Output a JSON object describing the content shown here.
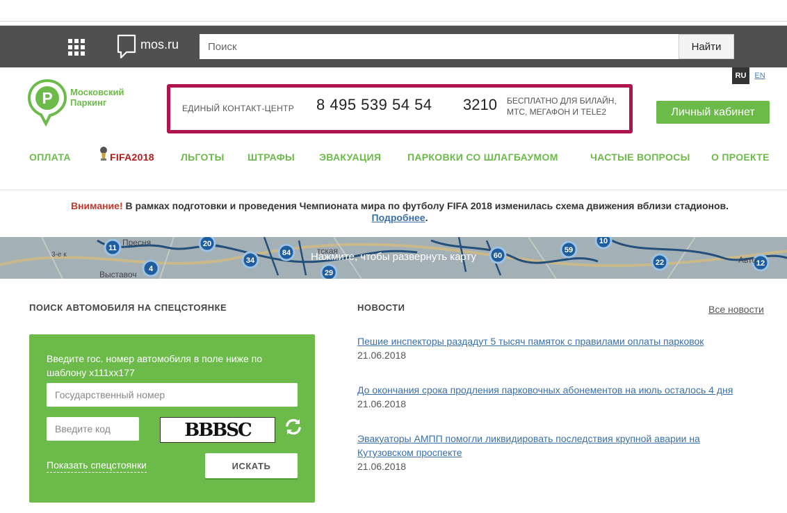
{
  "topbar": {
    "brand": "mos.ru",
    "search_placeholder": "Поиск",
    "search_button": "Найти"
  },
  "header": {
    "lang_ru": "RU",
    "lang_en": "EN",
    "logo_line1": "Московский",
    "logo_line2": "Паркинг",
    "contact_label": "ЕДИНЫЙ КОНТАКТ-ЦЕНТР",
    "contact_phone": "8 495 539 54 54",
    "contact_short": "3210",
    "contact_note": "БЕСПЛАТНО ДЛЯ БИЛАЙН, МТС, МЕГАФОН И TELE2",
    "cabinet_button": "Личный кабинет",
    "highlight_color": "#b0144f",
    "accent_color": "#6cba4a"
  },
  "nav": [
    {
      "label": "ОПЛАТА"
    },
    {
      "label": "FIFA2018"
    },
    {
      "label": "ЛЬГОТЫ"
    },
    {
      "label": "ШТРАФЫ"
    },
    {
      "label": "ЭВАКУАЦИЯ"
    },
    {
      "label": "ПАРКОВКИ СО ШЛАГБАУМОМ"
    },
    {
      "label": "ЧАСТЫЕ ВОПРОСЫ"
    },
    {
      "label": "О ПРОЕКТЕ"
    }
  ],
  "alert": {
    "warning": "Внимание!",
    "text": " В рамках подготовки и проведения Чемпионата мира по футболу FIFA 2018 изменилась схема движения вблизи стадионов. ",
    "link": "Подробнее",
    "end": "."
  },
  "map": {
    "text": "Нажмите, чтобы развернуть карту",
    "markers": [
      "11",
      "20",
      "4",
      "34",
      "84",
      "29",
      "60",
      "59",
      "10",
      "22",
      "12"
    ],
    "labels": [
      "Пресня",
      "Выставоч",
      "тская",
      "Авто",
      "3-е к"
    ]
  },
  "search_section": {
    "title": "ПОИСК АВТОМОБИЛЯ НА СПЕЦСТОЯНКЕ",
    "hint": "Введите гос. номер автомобиля в поле ниже по шаблону х111хх177",
    "plate_placeholder": "Государственный номер",
    "code_placeholder": "Введите код",
    "captcha_text": "BBBSC",
    "show_link": "Показать спецстоянки",
    "find_button": "ИСКАТЬ"
  },
  "news": {
    "title": "НОВОСТИ",
    "all_link": "Все новости",
    "items": [
      {
        "title": "Пешие инспекторы раздадут 5 тысяч памяток с правилами оплаты парковок",
        "date": "21.06.2018"
      },
      {
        "title": "До окончания срока продления парковочных абонементов на июль осталось 4 дня",
        "date": "21.06.2018"
      },
      {
        "title": "Эвакуаторы АМПП помогли ликвидировать последствия крупной аварии на Кутузовском проспекте",
        "date": "21.06.2018"
      }
    ]
  }
}
